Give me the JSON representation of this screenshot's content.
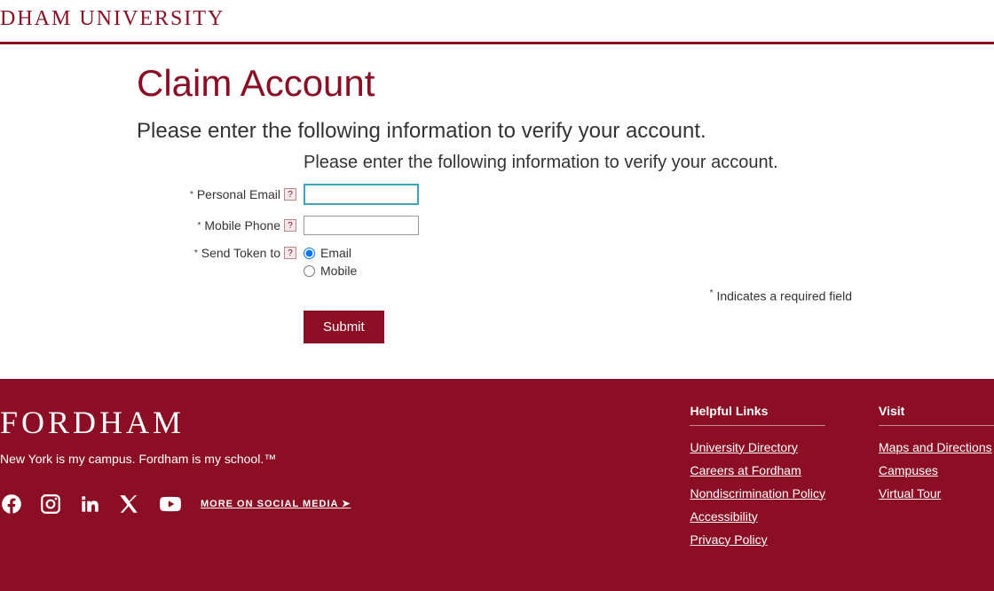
{
  "header": {
    "brand": "DHAM UNIVERSITY"
  },
  "main": {
    "title": "Claim Account",
    "subtitle": "Please enter the following information to verify your account.",
    "form_intro": "Please enter the following information to verify your account.",
    "fields": {
      "email_label": "Personal Email",
      "email_value": "",
      "phone_label": "Mobile Phone",
      "phone_value": "",
      "token_label": "Send Token to",
      "radio_email": "Email",
      "radio_mobile": "Mobile"
    },
    "help": "?",
    "required_note": "Indicates a required field",
    "submit": "Submit"
  },
  "footer": {
    "logo": "FORDHAM",
    "tagline": "New York is my campus. Fordham is my school.™",
    "more_social": "MORE ON SOCIAL MEDIA ➤",
    "helpful": {
      "title": "Helpful Links",
      "links": [
        "University Directory",
        "Careers at Fordham",
        "Nondiscrimination Policy",
        "Accessibility",
        "Privacy Policy"
      ]
    },
    "visit": {
      "title": "Visit",
      "links": [
        "Maps and Directions",
        "Campuses",
        "Virtual Tour"
      ]
    }
  }
}
